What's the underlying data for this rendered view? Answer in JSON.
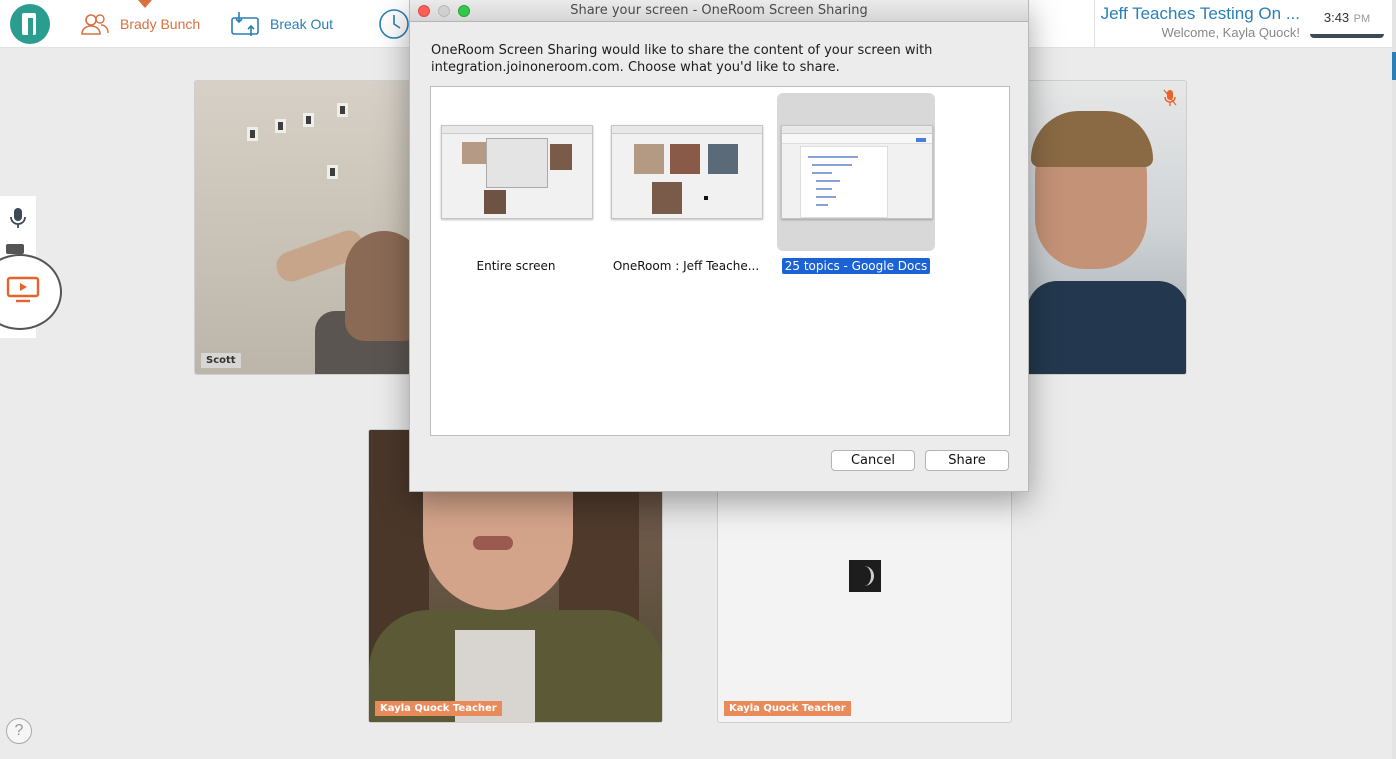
{
  "header": {
    "nav": [
      {
        "label": "Brady Bunch",
        "icon": "people-icon",
        "color": "#d9703f"
      },
      {
        "label": "Break Out",
        "icon": "breakout-icon",
        "color": "#2a7fb8"
      },
      {
        "label": "",
        "icon": "clock-icon"
      }
    ],
    "room_title": "Jeff Teaches Testing On ...",
    "welcome": "Welcome, Kayla Quock!",
    "time": "3:43",
    "ampm": "PM"
  },
  "controls": {
    "icons": [
      "microphone-icon",
      "camera-icon",
      "screen-share-icon"
    ],
    "help": "?"
  },
  "participants": [
    {
      "name": "Scott"
    },
    {
      "name": "",
      "muted": true
    },
    {
      "name": "Kayla Quock Teacher"
    },
    {
      "name": "Kayla Quock Teacher",
      "loading": true
    }
  ],
  "dialog": {
    "title": "Share your screen - OneRoom Screen Sharing",
    "message_line1": "OneRoom Screen Sharing would like to share the content of your screen with",
    "message_line2": "integration.joinoneroom.com. Choose what you'd like to share.",
    "choices": [
      {
        "label": "Entire screen",
        "selected": false
      },
      {
        "label": "OneRoom : Jeff Teache...",
        "selected": false
      },
      {
        "label": "25 topics - Google Docs",
        "selected": true
      }
    ],
    "cancel_label": "Cancel",
    "share_label": "Share"
  },
  "colors": {
    "accent_orange": "#d9703f",
    "accent_blue": "#2a7fb8",
    "selection_blue": "#1a62d6",
    "logo_teal": "#2a9d8f"
  }
}
